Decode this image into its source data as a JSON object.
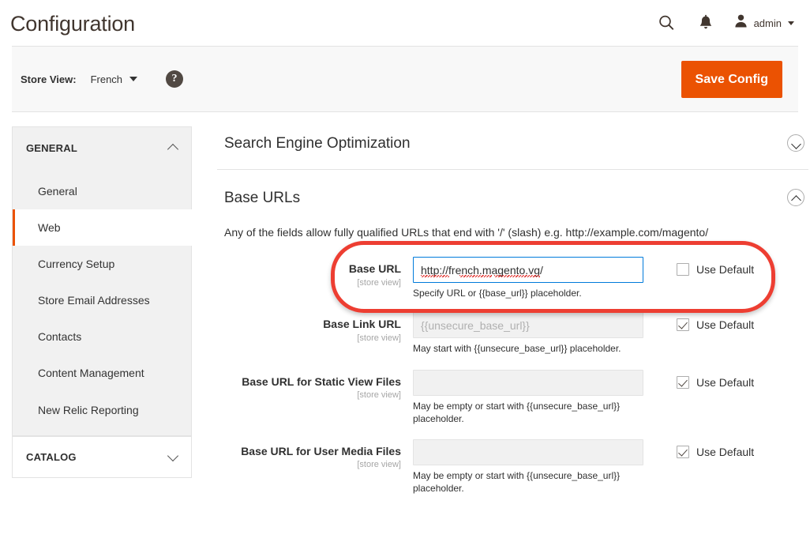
{
  "header": {
    "title": "Configuration",
    "search_icon": "search-icon",
    "notifications_icon": "bell-icon",
    "user_icon": "user-avatar-icon",
    "admin_label": "admin",
    "caret_icon": "caret-down-icon"
  },
  "storeview": {
    "label": "Store View:",
    "selected": "French",
    "caret_icon": "caret-down-icon",
    "help_icon": "question-mark-icon",
    "help_glyph": "?",
    "save_label": "Save Config"
  },
  "sidebar": {
    "sections": [
      {
        "title": "GENERAL",
        "expanded": true,
        "chevron_icon": "chevron-up-icon",
        "items": [
          {
            "label": "General",
            "active": false
          },
          {
            "label": "Web",
            "active": true
          },
          {
            "label": "Currency Setup",
            "active": false
          },
          {
            "label": "Store Email Addresses",
            "active": false
          },
          {
            "label": "Contacts",
            "active": false
          },
          {
            "label": "Content Management",
            "active": false
          },
          {
            "label": "New Relic Reporting",
            "active": false
          }
        ]
      },
      {
        "title": "CATALOG",
        "expanded": false,
        "chevron_icon": "chevron-down-icon",
        "items": []
      }
    ]
  },
  "main": {
    "sections": [
      {
        "title": "Search Engine Optimization",
        "expanded": false,
        "chevron_icon": "chevron-down-circle-icon"
      },
      {
        "title": "Base URLs",
        "expanded": true,
        "chevron_icon": "chevron-up-circle-icon"
      }
    ],
    "note": "Any of the fields allow fully qualified URLs that end with '/' (slash) e.g. http://example.com/magento/",
    "use_default_label": "Use Default",
    "fields": [
      {
        "label": "Base URL",
        "scope": "[store view]",
        "value": "http://french.magento.vg/",
        "placeholder": "",
        "hint": "Specify URL or {{base_url}} placeholder.",
        "use_default": false,
        "disabled": false,
        "focused": true,
        "spellcheck": true,
        "highlighted": true
      },
      {
        "label": "Base Link URL",
        "scope": "[store view]",
        "value": "",
        "placeholder": "{{unsecure_base_url}}",
        "hint": "May start with {{unsecure_base_url}} placeholder.",
        "use_default": true,
        "disabled": true,
        "focused": false,
        "spellcheck": false,
        "highlighted": false
      },
      {
        "label": "Base URL for Static View Files",
        "scope": "[store view]",
        "value": "",
        "placeholder": "",
        "hint": "May be empty or start with {{unsecure_base_url}} placeholder.",
        "use_default": true,
        "disabled": true,
        "focused": false,
        "spellcheck": false,
        "highlighted": false
      },
      {
        "label": "Base URL for User Media Files",
        "scope": "[store view]",
        "value": "",
        "placeholder": "",
        "hint": "May be empty or start with {{unsecure_base_url}} placeholder.",
        "use_default": true,
        "disabled": true,
        "focused": false,
        "spellcheck": false,
        "highlighted": false
      }
    ]
  },
  "colors": {
    "accent_orange": "#eb5202",
    "focus_blue": "#007bdb",
    "annotation_red": "#ed3e32",
    "panel_gray": "#f1f1f1",
    "bar_gray": "#f8f8f8",
    "text_dark": "#303030"
  }
}
